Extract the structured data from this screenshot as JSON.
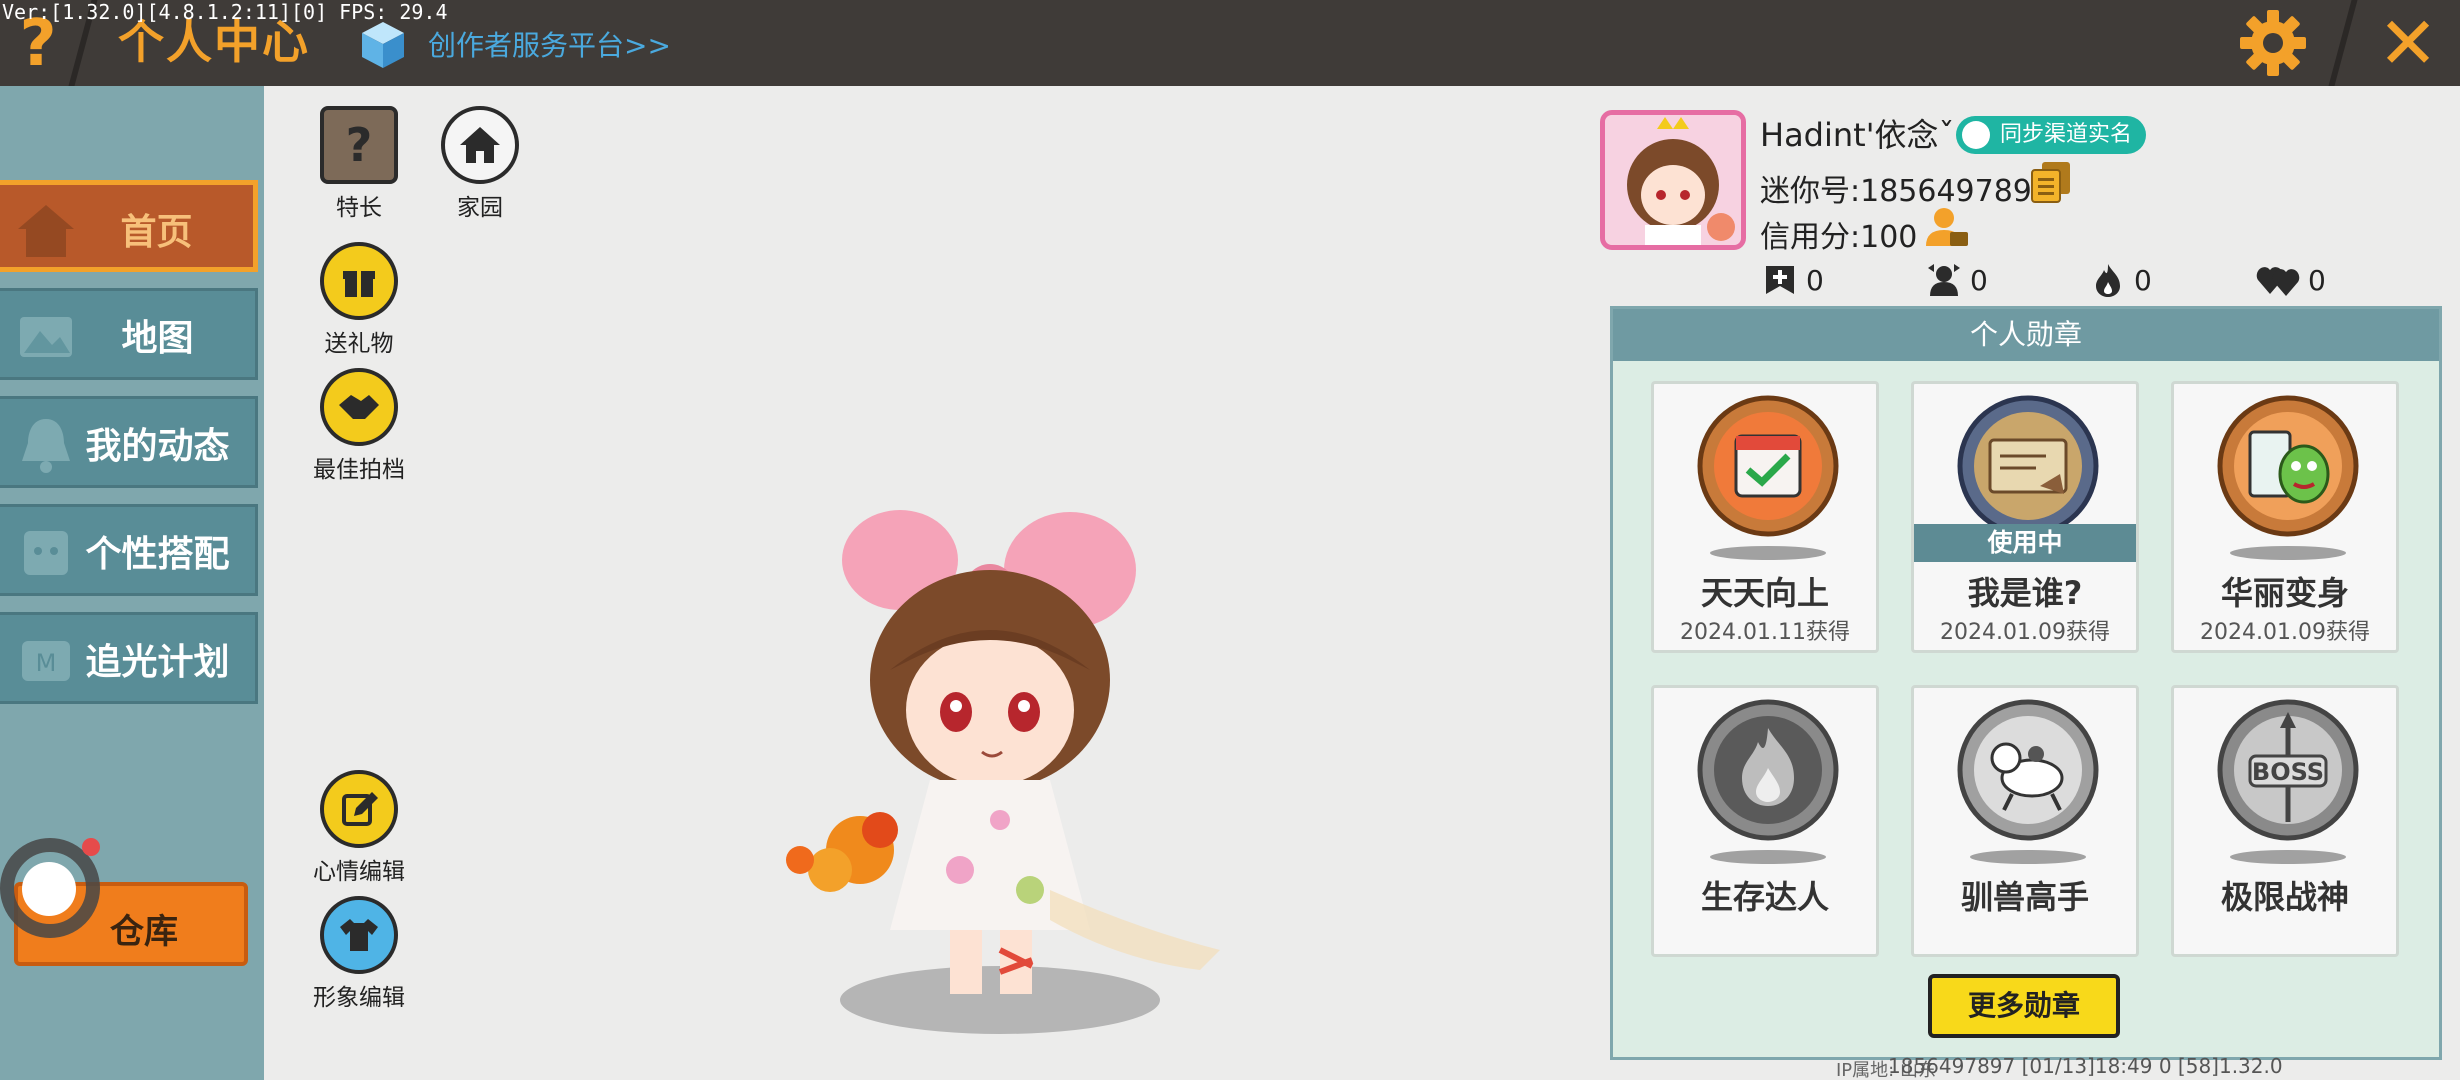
{
  "debug_text": "Ver:[1.32.0][4.8.1.2:11][0] FPS: 29.4",
  "header": {
    "title": "个人中心",
    "creator_link": "创作者服务平台>>"
  },
  "sidebar": {
    "items": [
      {
        "label": "首页",
        "icon": "home-icon",
        "active": true
      },
      {
        "label": "地图",
        "icon": "map-icon",
        "active": false
      },
      {
        "label": "我的动态",
        "icon": "bell-icon",
        "active": false
      },
      {
        "label": "个性搭配",
        "icon": "outfit-icon",
        "active": false
      },
      {
        "label": "追光计划",
        "icon": "light-icon",
        "active": false
      }
    ],
    "warehouse_label": "仓库"
  },
  "actions": {
    "specialty": "特长",
    "home": "家园",
    "gift": "送礼物",
    "partner": "最佳拍档",
    "mood": "心情编辑",
    "image": "形象编辑"
  },
  "profile": {
    "nickname": "Hadint'依念ˇ",
    "sync_label": "同步渠道实名",
    "mini_id": "迷你号:1856497897",
    "credit": "信用分:100",
    "stats": [
      {
        "icon": "like-icon",
        "value": "0"
      },
      {
        "icon": "fans-icon",
        "value": "0"
      },
      {
        "icon": "fire-icon",
        "value": "0"
      },
      {
        "icon": "hearts-icon",
        "value": "0"
      }
    ]
  },
  "medals": {
    "header": "个人勋章",
    "items": [
      {
        "name": "天天向上",
        "date": "2024.01.11获得",
        "in_use": false
      },
      {
        "name": "我是谁?",
        "date": "2024.01.09获得",
        "in_use": true
      },
      {
        "name": "华丽变身",
        "date": "2024.01.09获得",
        "in_use": false
      },
      {
        "name": "生存达人",
        "date": "",
        "in_use": false
      },
      {
        "name": "驯兽高手",
        "date": "",
        "in_use": false
      },
      {
        "name": "极限战神",
        "date": "",
        "in_use": false
      }
    ],
    "in_use_label": "使用中",
    "more_label": "更多勋章"
  },
  "footer": {
    "ip": "IP属地: 山东",
    "info": "1856497897    [01/13]18:49 0    [58]1.32.0"
  },
  "colors": {
    "accent_orange": "#f3a12a",
    "sidebar_bg": "#7fa7ad",
    "panel_header": "#6f9aa2",
    "in_use_bar": "#5d8b94",
    "more_button": "#f8d91a"
  }
}
